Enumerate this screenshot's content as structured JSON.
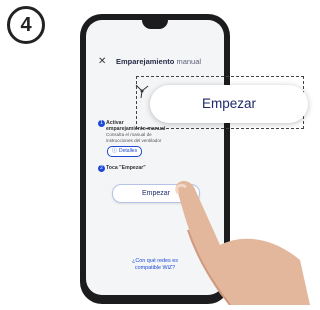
{
  "step_number": "4",
  "screen": {
    "close_icon": "close-icon",
    "title_bold": "Emparejamiento",
    "title_light": "manual",
    "step1_index": "1",
    "step1_line1": "Activar",
    "step1_line2": "emparejamiento manual",
    "step1_note1": "Consulta el manual de",
    "step1_note2": "instrucciones del ventilador",
    "details_label": "Detalles",
    "step2_index": "2",
    "step2_text": "Toca \"Empezar\"",
    "start_button": "Empezar",
    "compat_line1": "¿Con qué redes es",
    "compat_line2": "compatible WiZ?"
  },
  "zoom": {
    "start_button": "Empezar"
  },
  "colors": {
    "accent": "#1d49d8",
    "button_text": "#1d2a6a",
    "phone_frame": "#1c1c1e",
    "screen_bg": "#f4f5f7"
  }
}
